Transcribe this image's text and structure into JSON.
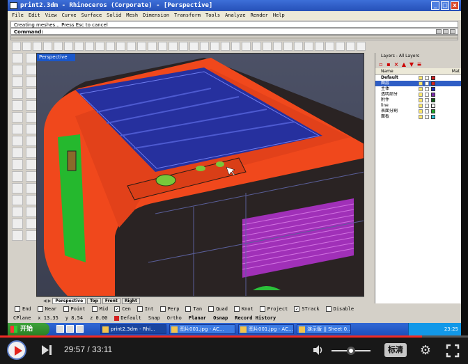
{
  "window": {
    "title": "print2.3dm - Rhinoceros (Corporate) - [Perspective]",
    "controls": [
      "_",
      "□",
      "x"
    ]
  },
  "menu": [
    "File",
    "Edit",
    "View",
    "Curve",
    "Surface",
    "Solid",
    "Mesh",
    "Dimension",
    "Transform",
    "Tools",
    "Analyze",
    "Render",
    "Help"
  ],
  "command": {
    "history": "Creating meshes... Press Esc to cancel",
    "prompt": "Command:"
  },
  "viewport": {
    "label": "Perspective",
    "tabs": [
      "Perspective",
      "Top",
      "Front",
      "Right"
    ]
  },
  "layers_panel": {
    "title": "Layers - All Layers",
    "col_name": "Name",
    "col_mat": "Mat",
    "layers": [
      {
        "name": "Default",
        "current": true,
        "color": "#d42020"
      },
      {
        "name": "图层",
        "selected": true,
        "color": "#d42020"
      },
      {
        "name": "主体",
        "color": "#1c2fb8"
      },
      {
        "name": "透明部分",
        "color": "#7b2aa8"
      },
      {
        "name": "附件",
        "color": "#0e5a18"
      },
      {
        "name": "line",
        "color": "#ffffff"
      },
      {
        "name": "表面分割",
        "color": "#1fa22a"
      },
      {
        "name": "面板",
        "color": "#2bc0d8"
      }
    ]
  },
  "osnaps": [
    {
      "label": "End",
      "checked": false
    },
    {
      "label": "Near",
      "checked": false
    },
    {
      "label": "Point",
      "checked": false
    },
    {
      "label": "Mid",
      "checked": false
    },
    {
      "label": "Cen",
      "checked": true
    },
    {
      "label": "Int",
      "checked": false
    },
    {
      "label": "Perp",
      "checked": false
    },
    {
      "label": "Tan",
      "checked": false
    },
    {
      "label": "Quad",
      "checked": false
    },
    {
      "label": "Knot",
      "checked": false
    },
    {
      "label": "Project",
      "checked": false
    },
    {
      "label": "STrack",
      "checked": true
    },
    {
      "label": "Disable",
      "checked": false
    }
  ],
  "status": {
    "cplane": "CPlane",
    "x": "x 13.35",
    "y": "y 8.54",
    "z": "z 0.00",
    "layer": "Default",
    "items": [
      "Snap",
      "Ortho",
      "Planar",
      "Osnap",
      "Record History"
    ]
  },
  "taskbar": {
    "start": "开始",
    "tasks": [
      {
        "label": "print2.3dm - Rhi..."
      },
      {
        "label": "图片001.jpg - AC..."
      },
      {
        "label": "图片001.jpg - AC..."
      },
      {
        "label": "演示版 || Sheet 0..."
      }
    ],
    "clock": "23:25"
  },
  "player": {
    "current_time": "29:57",
    "total_time": "33:11",
    "time_separator": " / ",
    "cc_label": "标清",
    "progress": 0.902,
    "volume": 0.5
  }
}
